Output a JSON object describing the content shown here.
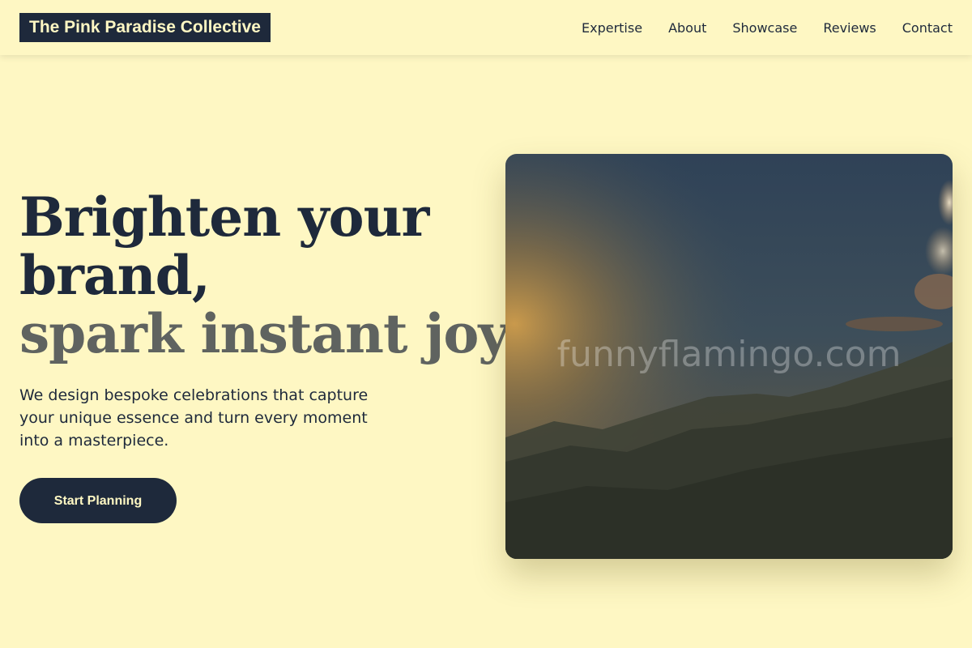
{
  "header": {
    "logo": "The Pink Paradise Collective",
    "nav": [
      "Expertise",
      "About",
      "Showcase",
      "Reviews",
      "Contact"
    ]
  },
  "hero": {
    "headline_line1": "Brighten your",
    "headline_line2": "brand,",
    "headline_line3": "spark instant joy.",
    "subtext": "We design bespoke celebrations that capture your unique essence and turn every moment into a masterpiece.",
    "cta_label": "Start Planning",
    "image_watermark": "funnyflamingo.com"
  },
  "colors": {
    "background": "#fef7c3",
    "primary_dark": "#1e293b",
    "accent_gray": "#5f6360"
  }
}
